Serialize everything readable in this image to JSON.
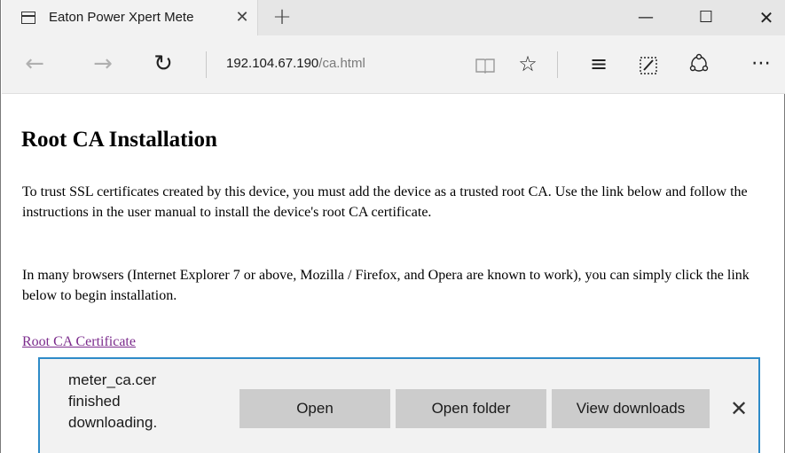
{
  "tab": {
    "title": "Eaton Power Xpert Mete",
    "icon": "tab-page-icon",
    "close_glyph": "✕",
    "new_tab_glyph": "+"
  },
  "window_controls": {
    "minimize_glyph": "—",
    "maximize_glyph": "☐",
    "close_glyph": "✕"
  },
  "address_bar": {
    "host": "192.104.67.190",
    "path": "/ca.html"
  },
  "nav_icons": {
    "back": "←",
    "forward": "→",
    "refresh": "↻",
    "reading_view": "📖",
    "favorite": "☆",
    "hub": "≡",
    "web_note": "✎",
    "share": "⇪",
    "more": "⋯"
  },
  "page": {
    "title": "Root CA Installation",
    "paragraph1": "To trust SSL certificates created by this device, you must add the device as a trusted root CA. Use the link below and follow the instructions in the user manual to install the device's root CA certificate.",
    "paragraph2": "In many browsers (Internet Explorer 7 or above, Mozilla / Firefox, and Opera are known to work), you can simply click the link below to begin installation.",
    "link_text": "Root CA Certificate",
    "link_color": "#7b2b8c"
  },
  "download_bar": {
    "filename": "meter_ca.cer",
    "status_line1": "finished",
    "status_line2": "downloading.",
    "open_label": "Open",
    "open_folder_label": "Open folder",
    "view_downloads_label": "View downloads",
    "close_glyph": "✕",
    "accent_color": "#2e8bc8"
  }
}
